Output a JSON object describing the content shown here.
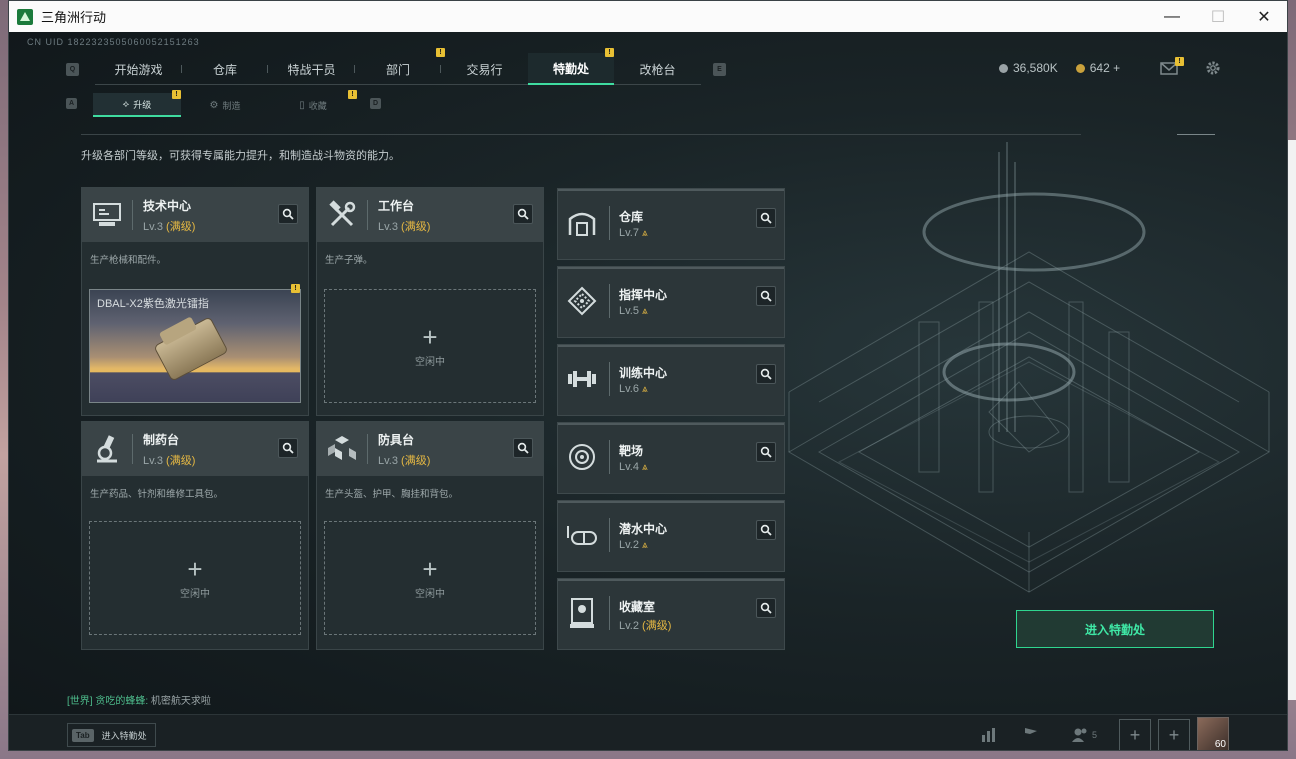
{
  "window": {
    "title": "三角洲行动",
    "minimize": "—",
    "maximize": "☐",
    "close": "✕"
  },
  "uid": "CN UID 1822323505060052151263",
  "nav": {
    "key_left": "Q",
    "key_right": "E",
    "tabs": [
      {
        "label": "开始游戏"
      },
      {
        "label": "仓库"
      },
      {
        "label": "特战干员"
      },
      {
        "label": "部门",
        "badge": "!"
      },
      {
        "label": "交易行"
      },
      {
        "label": "特勤处",
        "badge": "!",
        "active": true
      },
      {
        "label": "改枪台"
      }
    ]
  },
  "currency": {
    "silver": "36,580K",
    "gold": "642 +",
    "mail_badge": "!"
  },
  "subnav": {
    "key_left": "A",
    "key_right": "D",
    "tabs": [
      {
        "label": "升级",
        "badge": "!",
        "active": true
      },
      {
        "label": "制造"
      },
      {
        "label": "收藏",
        "badge": "!"
      }
    ]
  },
  "description": "升级各部门等级，可获得专属能力提升，和制造战斗物资的能力。",
  "cards": [
    {
      "name": "技术中心",
      "lv": "Lv.3",
      "max": "(满级)",
      "desc": "生产枪械和配件。",
      "item": "DBAL-X2紫色激光镭指",
      "item_badge": "!"
    },
    {
      "name": "工作台",
      "lv": "Lv.3",
      "max": "(满级)",
      "desc": "生产子弹。",
      "idle": "空闲中"
    },
    {
      "name": "制药台",
      "lv": "Lv.3",
      "max": "(满级)",
      "desc": "生产药品、针剂和维修工具包。",
      "idle": "空闲中"
    },
    {
      "name": "防具台",
      "lv": "Lv.3",
      "max": "(满级)",
      "desc": "生产头盔、护甲、胸挂和背包。",
      "idle": "空闲中"
    }
  ],
  "facilities": [
    {
      "name": "仓库",
      "lv": "Lv.7",
      "up": "⩓"
    },
    {
      "name": "指挥中心",
      "lv": "Lv.5",
      "up": "⩓"
    },
    {
      "name": "训练中心",
      "lv": "Lv.6",
      "up": "⩓"
    },
    {
      "name": "靶场",
      "lv": "Lv.4",
      "up": "⩓"
    },
    {
      "name": "潜水中心",
      "lv": "Lv.2",
      "up": "⩓"
    },
    {
      "name": "收藏室",
      "lv": "Lv.2",
      "max": "(满级)"
    }
  ],
  "enter_button": "进入特勤处",
  "chat": {
    "channel": "[世界]",
    "user": "贪吃的蜂蜂:",
    "message": "机密航天求啦"
  },
  "bottom": {
    "key": "Tab",
    "label": "进入特勤处",
    "friends": "5",
    "level": "60"
  },
  "colors": {
    "accent": "#3fdca0",
    "gold": "#e5b843",
    "badge": "#e8c034"
  }
}
